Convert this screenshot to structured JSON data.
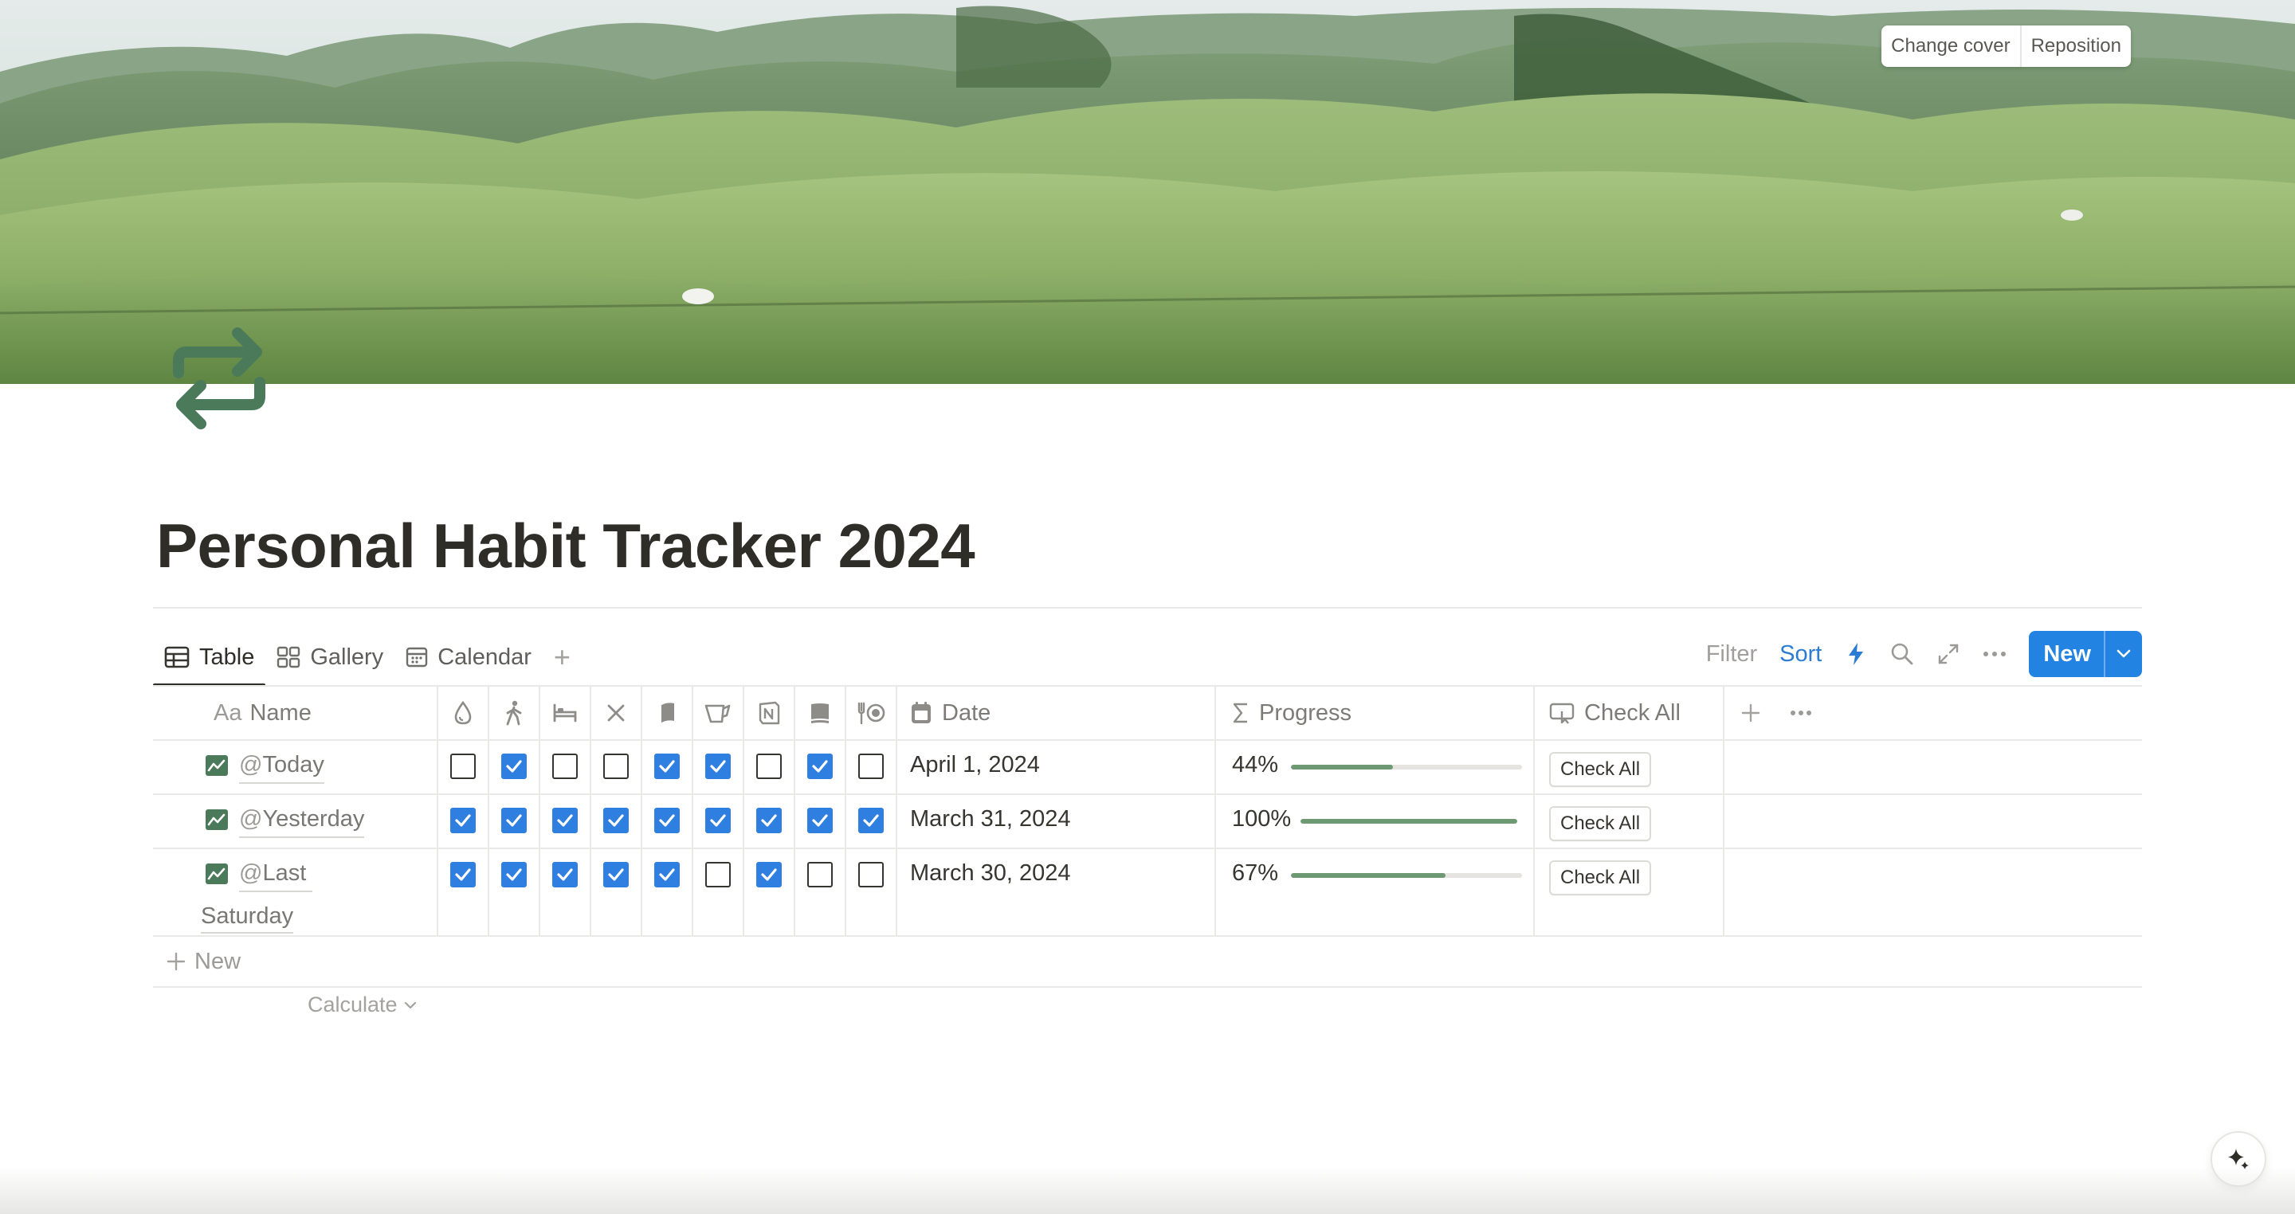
{
  "cover": {
    "change_cover_label": "Change cover",
    "reposition_label": "Reposition"
  },
  "page": {
    "icon": "repeat-arrows-icon",
    "title": "Personal Habit Tracker 2024"
  },
  "views": {
    "tabs": [
      {
        "label": "Table",
        "icon": "table-icon",
        "active": true
      },
      {
        "label": "Gallery",
        "icon": "gallery-icon",
        "active": false
      },
      {
        "label": "Calendar",
        "icon": "calendar-icon",
        "active": false
      }
    ],
    "add_label": "+"
  },
  "toolbar": {
    "filter_label": "Filter",
    "sort_label": "Sort",
    "new_label": "New"
  },
  "table": {
    "columns": {
      "name": "Name",
      "name_prefix": "Aa",
      "date": "Date",
      "progress": "Progress",
      "check_all": "Check All"
    },
    "habit_icons": [
      "water-drop-icon",
      "walking-icon",
      "bed-icon",
      "x-icon",
      "book-icon",
      "kettle-icon",
      "notion-icon",
      "journal-icon",
      "meal-icon"
    ],
    "rows": [
      {
        "at": "@",
        "name": "Today",
        "name_line2": "",
        "checks": [
          false,
          true,
          false,
          false,
          true,
          true,
          false,
          true,
          false
        ],
        "date": "April 1, 2024",
        "progress_label": "44%",
        "progress": 0.44,
        "button": "Check All"
      },
      {
        "at": "@",
        "name": "Yesterday",
        "name_line2": "",
        "checks": [
          true,
          true,
          true,
          true,
          true,
          true,
          true,
          true,
          true
        ],
        "date": "March 31, 2024",
        "progress_label": "100%",
        "progress": 1.0,
        "button": "Check All"
      },
      {
        "at": "@",
        "name": "Last",
        "name_line2": "Saturday",
        "checks": [
          true,
          true,
          true,
          true,
          true,
          false,
          true,
          false,
          false
        ],
        "date": "March 30, 2024",
        "progress_label": "67%",
        "progress": 0.67,
        "button": "Check All"
      }
    ],
    "new_row_label": "New",
    "calculate_label": "Calculate"
  },
  "colors": {
    "accent": "#2383e2",
    "checkbox": "#2f7fe0",
    "progress": "#6e9a73",
    "icon_green": "#4a7a5a"
  }
}
